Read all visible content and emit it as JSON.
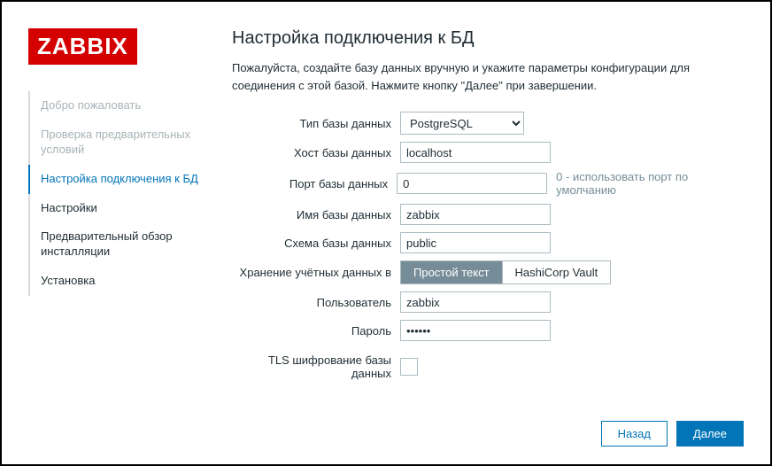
{
  "logo": "ZABBIX",
  "nav": {
    "items": [
      {
        "label": "Добро пожаловать"
      },
      {
        "label": "Проверка предварительных условий"
      },
      {
        "label": "Настройка подключения к БД"
      },
      {
        "label": "Настройки"
      },
      {
        "label": "Предварительный обзор инсталляции"
      },
      {
        "label": "Установка"
      }
    ]
  },
  "page": {
    "title": "Настройка подключения к БД",
    "desc": "Пожалуйста, создайте базу данных вручную и укажите параметры конфигурации для соединения с этой базой. Нажмите кнопку \"Далее\" при завершении."
  },
  "form": {
    "db_type": {
      "label": "Тип базы данных",
      "value": "PostgreSQL"
    },
    "db_host": {
      "label": "Хост базы данных",
      "value": "localhost"
    },
    "db_port": {
      "label": "Порт базы данных",
      "value": "0",
      "hint": "0 - использовать порт по умолчанию"
    },
    "db_name": {
      "label": "Имя базы данных",
      "value": "zabbix"
    },
    "db_schema": {
      "label": "Схема базы данных",
      "value": "public"
    },
    "creds_store": {
      "label": "Хранение учётных данных в",
      "opt1": "Простой текст",
      "opt2": "HashiCorp Vault"
    },
    "user": {
      "label": "Пользователь",
      "value": "zabbix"
    },
    "password": {
      "label": "Пароль",
      "value": "••••••"
    },
    "tls": {
      "label": "TLS шифрование базы данных"
    }
  },
  "buttons": {
    "back": "Назад",
    "next": "Далее"
  }
}
